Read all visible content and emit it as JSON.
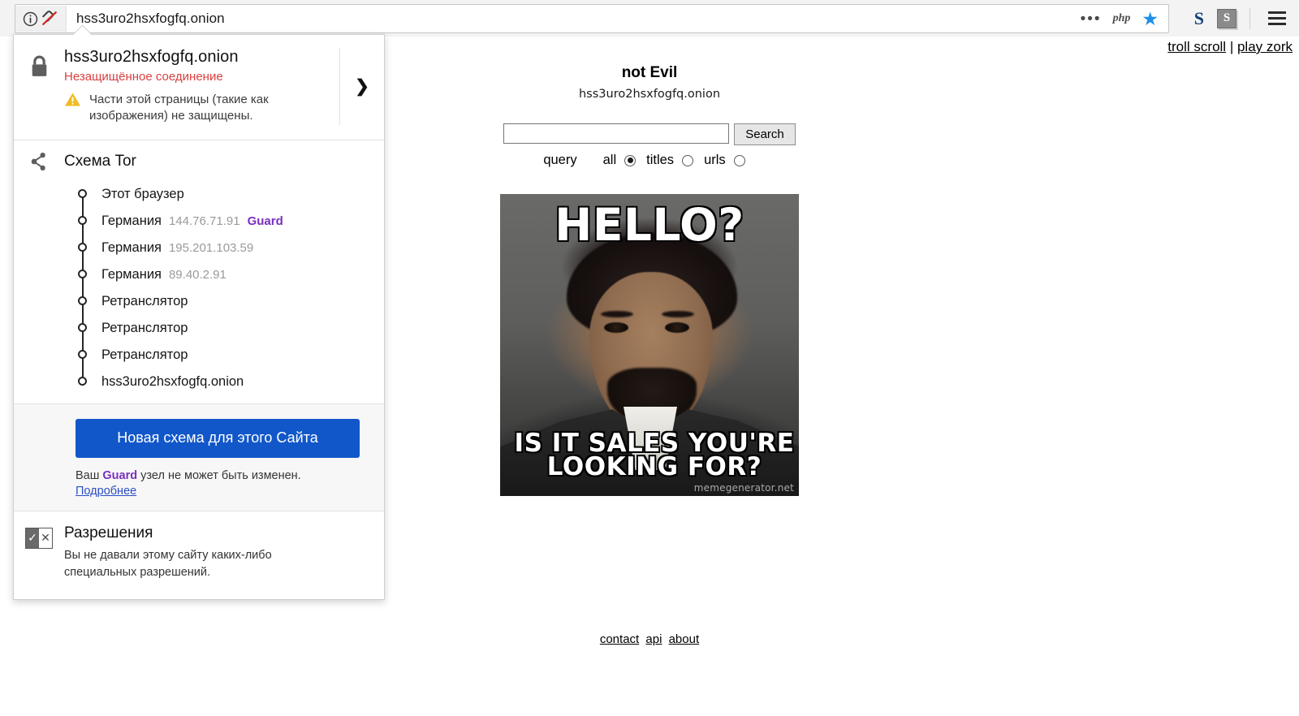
{
  "browser": {
    "url": "hss3uro2hsxfogfq.onion",
    "icons": {
      "info": "info-icon",
      "noscript": "noscript-icon",
      "overflow": "•••",
      "php": "php",
      "bookmark_star": "★",
      "ext_s1": "S",
      "ext_s2": "S",
      "menu": "hamburger-icon"
    }
  },
  "identity_panel": {
    "host": "hss3uro2hsxfogfq.onion",
    "status": "Незащищённое соединение",
    "warning": "Части этой страницы (такие как изображения) не защищены.",
    "expand_chevron": "❯",
    "lock_icon": "lock-icon",
    "warning_icon": "warning-triangle-icon",
    "circuit": {
      "icon": "tor-circuit-icon",
      "title": "Схема Tor",
      "nodes": [
        {
          "label": "Этот браузер",
          "ip": "",
          "tag": ""
        },
        {
          "label": "Германия",
          "ip": "144.76.71.91",
          "tag": "Guard"
        },
        {
          "label": "Германия",
          "ip": "195.201.103.59",
          "tag": ""
        },
        {
          "label": "Германия",
          "ip": "89.40.2.91",
          "tag": ""
        },
        {
          "label": "Ретранслятор",
          "ip": "",
          "tag": ""
        },
        {
          "label": "Ретранслятор",
          "ip": "",
          "tag": ""
        },
        {
          "label": "Ретранслятор",
          "ip": "",
          "tag": ""
        },
        {
          "label": "hss3uro2hsxfogfq.onion",
          "ip": "",
          "tag": ""
        }
      ]
    },
    "new_circuit": {
      "button_label": "Новая схема для этого Сайта",
      "note_prefix": "Ваш ",
      "note_guard": "Guard",
      "note_suffix": " узел не может быть изменен.",
      "learn_more": "Подробнее"
    },
    "permissions": {
      "icon": "permissions-icon",
      "title": "Разрешения",
      "text": "Вы не давали этому сайту каких-либо специальных разрешений."
    }
  },
  "page": {
    "top_links": {
      "troll": "troll scroll",
      "separator": " | ",
      "zork": "play zork"
    },
    "title": "not Evil",
    "host": "hss3uro2hsxfogfq.onion",
    "search": {
      "value": "",
      "placeholder": "",
      "button_label": "Search",
      "query_label": "query",
      "options": [
        {
          "label": "all",
          "selected": true
        },
        {
          "label": "titles",
          "selected": false
        },
        {
          "label": "urls",
          "selected": false
        }
      ]
    },
    "meme": {
      "alt": "hello-is-it-sales-youre-looking-for-meme",
      "top_text": "HELLO?",
      "bottom_text": "IS IT SALES YOU'RE LOOKING FOR?",
      "watermark": "memegenerator.net"
    },
    "footer": {
      "contact": "contact",
      "api": "api",
      "about": "about"
    }
  },
  "colors": {
    "accent_blue": "#1157c9",
    "guard_purple": "#7b2fbe",
    "insecure_red": "#d94040",
    "link_blue": "#2b4fc4"
  }
}
